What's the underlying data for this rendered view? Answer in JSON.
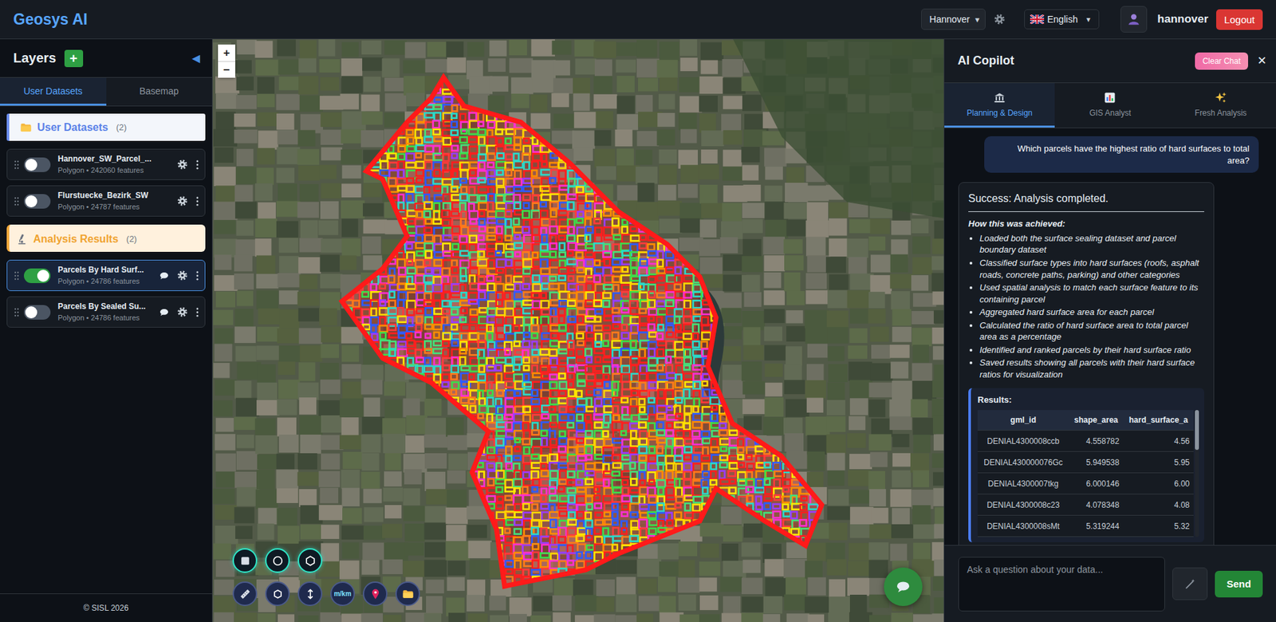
{
  "header": {
    "logo": "Geosys AI",
    "city": "Hannover",
    "city_caret": "▾",
    "language": "English",
    "language_caret": "▼",
    "user": "hannover",
    "logout": "Logout"
  },
  "sidebar": {
    "title": "Layers",
    "add": "+",
    "collapse": "◀",
    "tabs": [
      {
        "label": "User Datasets",
        "selected": true
      },
      {
        "label": "Basemap",
        "selected": false
      }
    ],
    "sections": [
      {
        "title": "User Datasets",
        "count": "(2)",
        "kind": "datasets",
        "layers": [
          {
            "name": "Hannover_SW_Parcel_...",
            "meta": "Polygon • 242060 features",
            "on": false,
            "selected": false,
            "chat": false
          },
          {
            "name": "Flurstuecke_Bezirk_SW",
            "meta": "Polygon • 24787 features",
            "on": false,
            "selected": false,
            "chat": false
          }
        ]
      },
      {
        "title": "Analysis Results",
        "count": "(2)",
        "kind": "results",
        "layers": [
          {
            "name": "Parcels By Hard Surf...",
            "meta": "Polygon • 24786 features",
            "on": true,
            "selected": true,
            "chat": true
          },
          {
            "name": "Parcels By Sealed Su...",
            "meta": "Polygon • 24786 features",
            "on": false,
            "selected": false,
            "chat": true
          }
        ]
      }
    ],
    "footer": "© SISL 2026"
  },
  "map": {
    "zoom_in": "+",
    "zoom_out": "−",
    "unit_toggle": "m/km"
  },
  "copilot": {
    "title": "AI Copilot",
    "clear": "Clear Chat",
    "close": "✕",
    "tabs": [
      {
        "label": "Planning & Design",
        "selected": true
      },
      {
        "label": "GIS Analyst",
        "selected": false
      },
      {
        "label": "Fresh Analysis",
        "selected": false
      }
    ],
    "question": "Which parcels have the highest ratio of hard surfaces to total area?",
    "answer": {
      "status": "Success: Analysis completed.",
      "steps_title": "How this was achieved:",
      "steps": [
        "Loaded both the surface sealing dataset and parcel boundary dataset",
        "Classified surface types into hard surfaces (roofs, asphalt roads, concrete paths, parking) and other categories",
        "Used spatial analysis to match each surface feature to its containing parcel",
        "Aggregated hard surface area for each parcel",
        "Calculated the ratio of hard surface area to total parcel area as a percentage",
        "Identified and ranked parcels by their hard surface ratio",
        "Saved results showing all parcels with their hard surface ratios for visualization"
      ],
      "results_title": "Results:",
      "columns": [
        "gml_id",
        "shape_area",
        "hard_surface_a"
      ],
      "rows": [
        [
          "DENIAL4300008ccb",
          "4.558782",
          "4.56"
        ],
        [
          "DENIAL430000076Gc",
          "5.949538",
          "5.95"
        ],
        [
          "DENIAL4300007tkg",
          "6.000146",
          "6.00"
        ],
        [
          "DENIAL4300008c23",
          "4.078348",
          "4.08"
        ],
        [
          "DENIAL4300008sMt",
          "5.319244",
          "5.32"
        ]
      ]
    },
    "placeholder": "Ask a question about your data...",
    "send": "Send"
  }
}
